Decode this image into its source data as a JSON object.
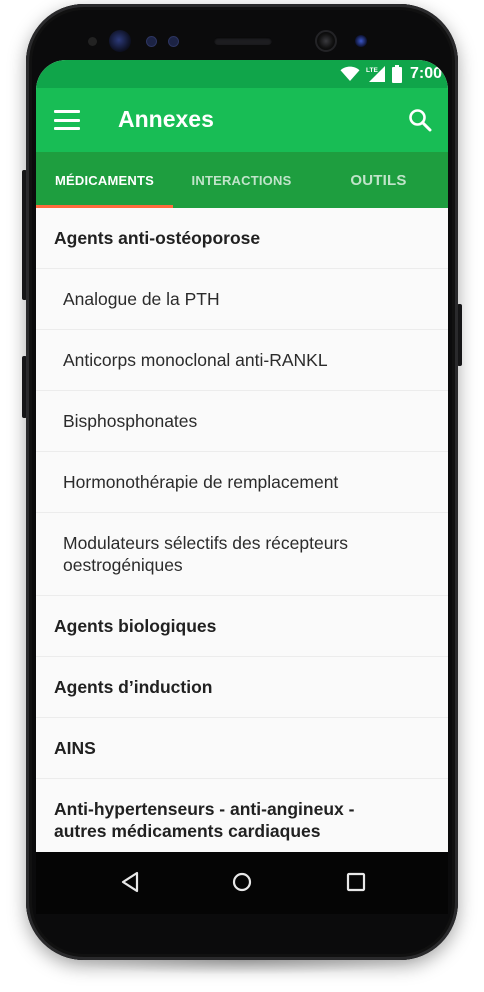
{
  "status_bar": {
    "time": "7:00",
    "icons": [
      "wifi-icon",
      "lte-signal-icon",
      "battery-icon"
    ],
    "network_label": "LTE"
  },
  "app_bar": {
    "title": "Annexes",
    "menu_icon": "hamburger-menu-icon",
    "search_icon": "search-icon"
  },
  "tabs": [
    {
      "label": "MÉDICAMENTS",
      "active": true
    },
    {
      "label": "INTERACTIONS",
      "active": false
    },
    {
      "label": "OUTILS",
      "active": false
    }
  ],
  "list": {
    "rows": [
      {
        "label": "Agents anti-ostéoporose",
        "type": "header"
      },
      {
        "label": "Analogue de la PTH",
        "type": "item"
      },
      {
        "label": "Anticorps monoclonal anti-RANKL",
        "type": "item"
      },
      {
        "label": "Bisphosphonates",
        "type": "item"
      },
      {
        "label": "Hormonothérapie de remplacement",
        "type": "item"
      },
      {
        "label": "Modulateurs sélectifs des récepteurs oestrogéniques",
        "type": "item"
      },
      {
        "label": "Agents biologiques",
        "type": "header"
      },
      {
        "label": "Agents d’induction",
        "type": "header"
      },
      {
        "label": "AINS",
        "type": "header"
      },
      {
        "label": "Anti-hypertenseurs - anti-angineux - autres médicaments cardiaques",
        "type": "header"
      }
    ]
  },
  "nav_bar": {
    "icons": [
      "back-icon",
      "home-icon",
      "recents-icon"
    ]
  },
  "colors": {
    "status_bar": "#10a54a",
    "app_bar": "#18bd55",
    "tab_bar": "#1e9e3f",
    "tab_indicator": "#ff6a3d",
    "list_background": "#fafafa"
  }
}
